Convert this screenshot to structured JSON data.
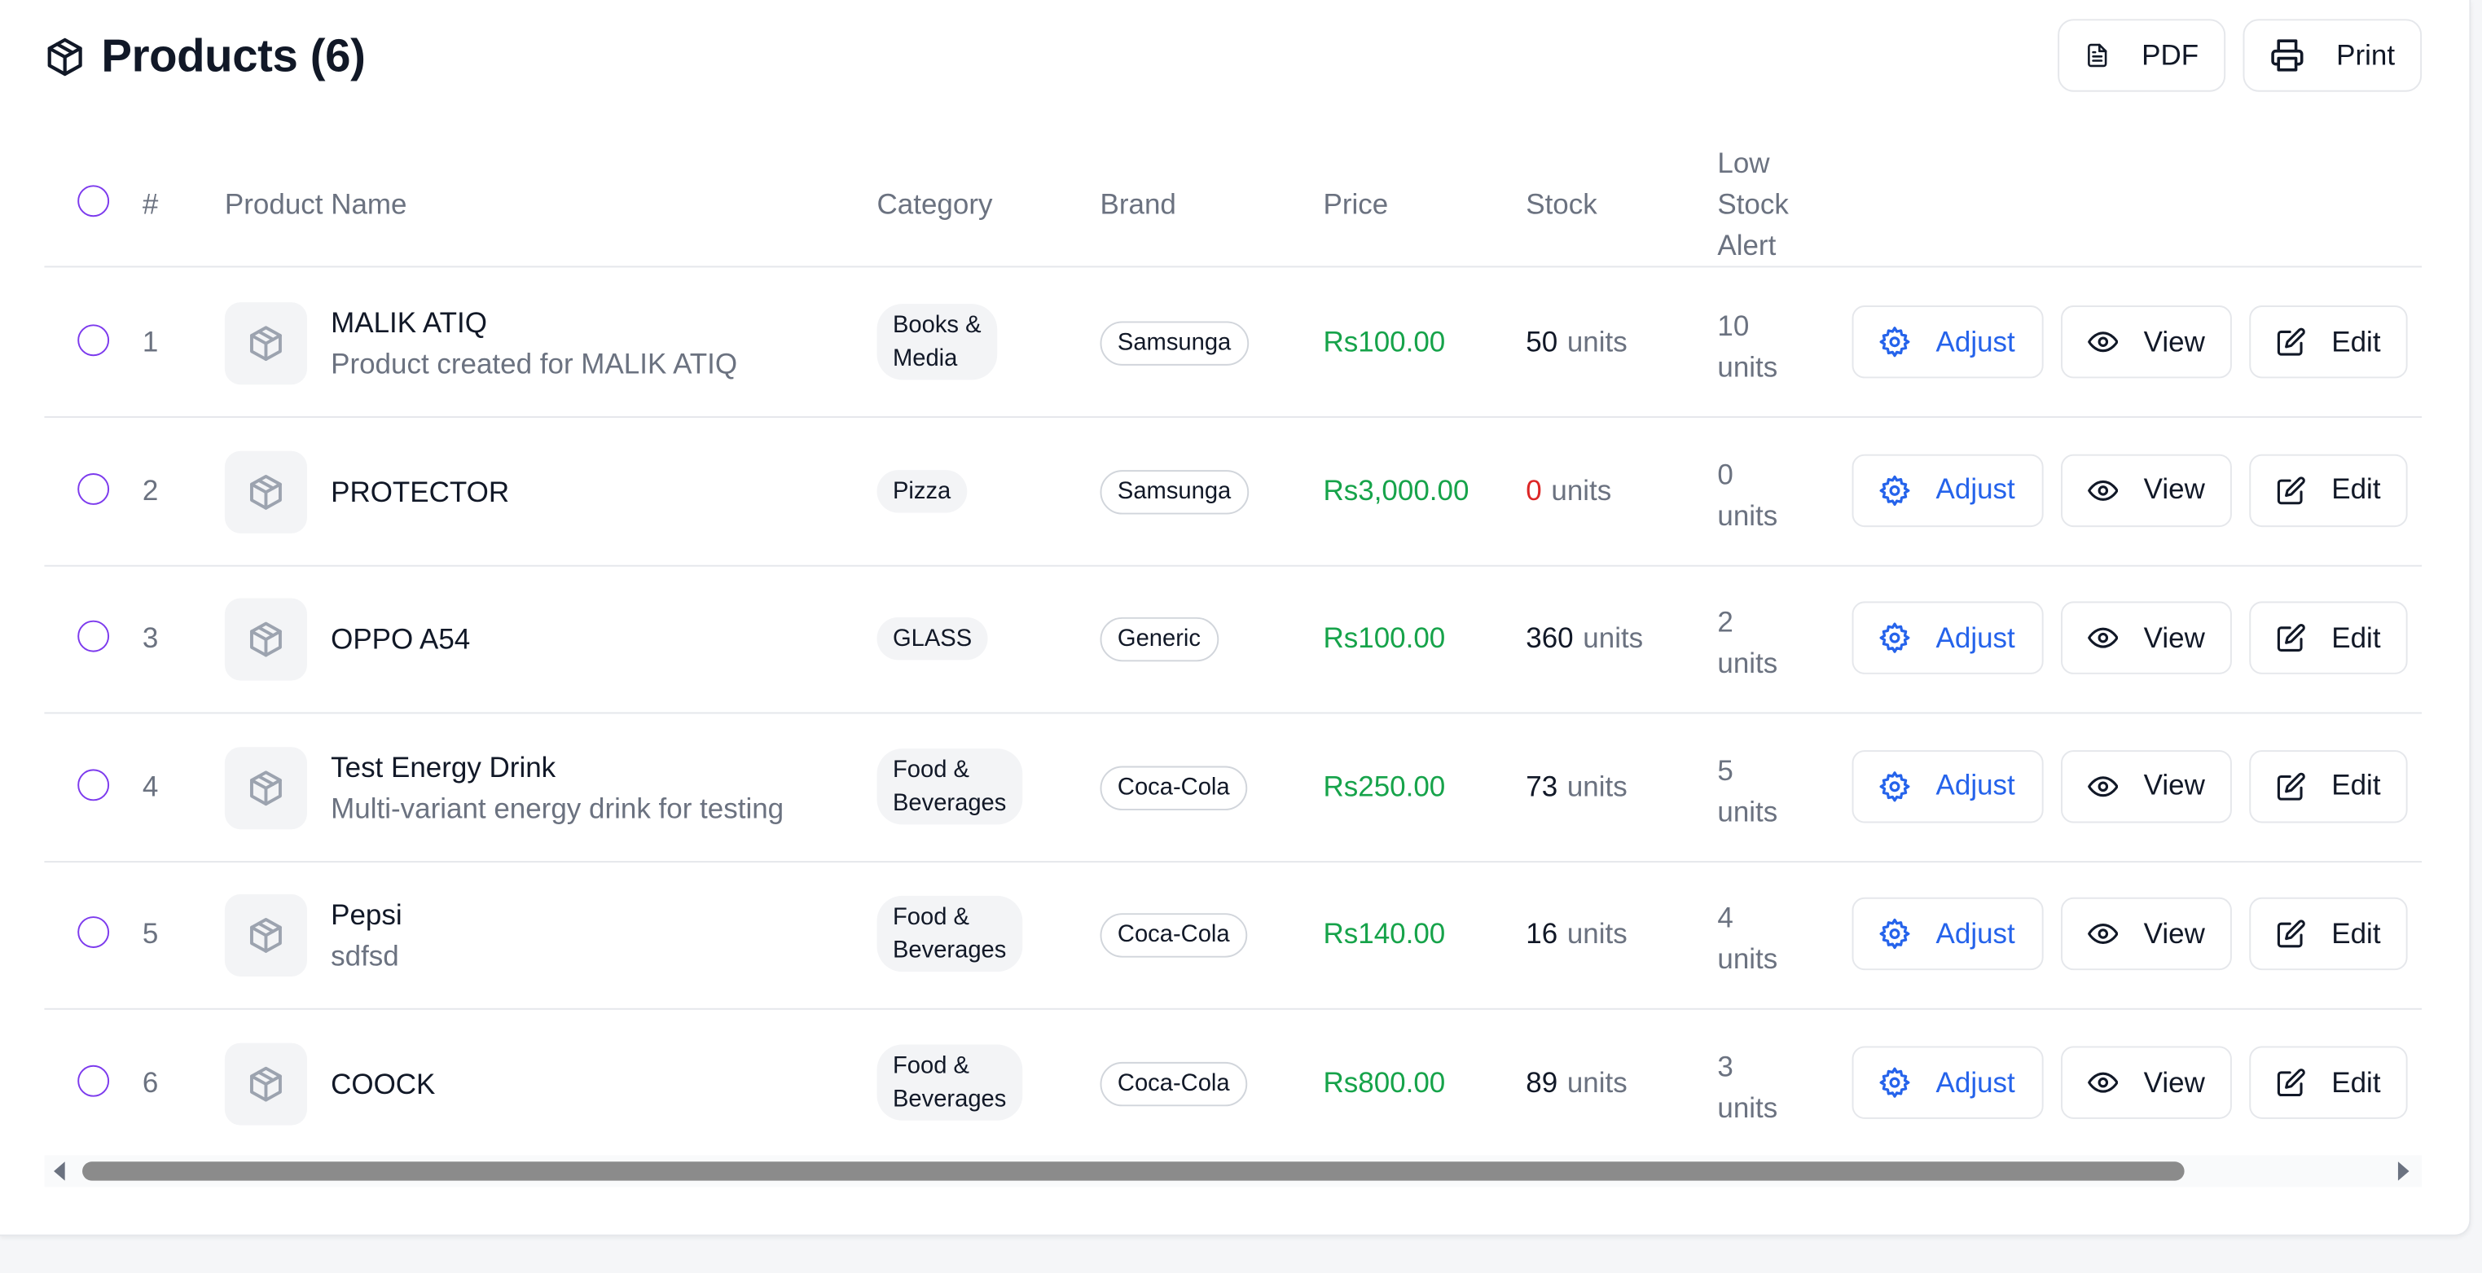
{
  "header": {
    "title": "Products (6)",
    "pdf_label": "PDF",
    "print_label": "Print"
  },
  "table": {
    "columns": [
      "#",
      "Product Name",
      "Category",
      "Brand",
      "Price",
      "Stock",
      "Low Stock Alert"
    ],
    "low_stock_header_lines": [
      "Low",
      "Stock",
      "Alert"
    ],
    "actions": {
      "adjust": "Adjust",
      "view": "View",
      "edit": "Edit"
    },
    "stock_unit": "units",
    "rows": [
      {
        "index": "1",
        "name": "MALIK ATIQ",
        "description": "Product created for MALIK ATIQ",
        "category_lines": [
          "Books &",
          "Media"
        ],
        "brand": "Samsunga",
        "price": "Rs100.00",
        "stock": "50",
        "low_stock_value": "10",
        "low_stock_unit": "units"
      },
      {
        "index": "2",
        "name": "PROTECTOR",
        "description": "",
        "category_lines": [
          "Pizza"
        ],
        "brand": "Samsunga",
        "price": "Rs3,000.00",
        "stock": "0",
        "low_stock_value": "0",
        "low_stock_unit": "units"
      },
      {
        "index": "3",
        "name": "OPPO A54",
        "description": "",
        "category_lines": [
          "GLASS"
        ],
        "brand": "Generic",
        "price": "Rs100.00",
        "stock": "360",
        "low_stock_value": "2",
        "low_stock_unit": "units"
      },
      {
        "index": "4",
        "name": "Test Energy Drink",
        "description": "Multi-variant energy drink for testing",
        "category_lines": [
          "Food &",
          "Beverages"
        ],
        "brand": "Coca-Cola",
        "price": "Rs250.00",
        "stock": "73",
        "low_stock_value": "5",
        "low_stock_unit": "units"
      },
      {
        "index": "5",
        "name": "Pepsi",
        "description": "sdfsd",
        "category_lines": [
          "Food &",
          "Beverages"
        ],
        "brand": "Coca-Cola",
        "price": "Rs140.00",
        "stock": "16",
        "low_stock_value": "4",
        "low_stock_unit": "units"
      },
      {
        "index": "6",
        "name": "COOCK",
        "description": "",
        "category_lines": [
          "Food &",
          "Beverages"
        ],
        "brand": "Coca-Cola",
        "price": "Rs800.00",
        "stock": "89",
        "low_stock_value": "3",
        "low_stock_unit": "units"
      }
    ]
  },
  "colors": {
    "accent_radio": "#7c3aed",
    "price_green": "#16a34a",
    "zero_stock_red": "#dc2626",
    "adjust_blue": "#2563eb"
  },
  "icons": {
    "title": "package-icon",
    "pdf": "file-text-icon",
    "print": "printer-icon",
    "thumb": "package-icon",
    "adjust": "gear-icon",
    "view": "eye-icon",
    "edit": "edit-icon"
  }
}
